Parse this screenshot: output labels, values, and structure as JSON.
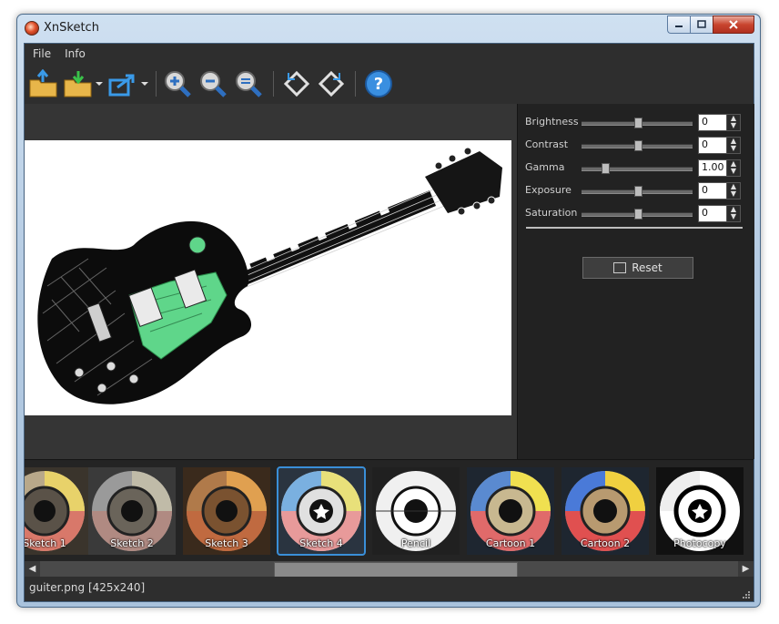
{
  "window": {
    "title": "XnSketch"
  },
  "menu": {
    "items": [
      "File",
      "Info"
    ]
  },
  "toolbar": {
    "buttons": [
      "open-icon",
      "save-icon",
      "export-icon",
      "zoom-in-icon",
      "zoom-out-icon",
      "zoom-fit-icon",
      "rotate-left-icon",
      "rotate-right-icon",
      "help-icon"
    ],
    "help_label": "?"
  },
  "adjustments": [
    {
      "label": "Brightness",
      "value": "0",
      "level": 0.5
    },
    {
      "label": "Contrast",
      "value": "0",
      "level": 0.5
    },
    {
      "label": "Gamma",
      "value": "1.00",
      "level": 0.2
    },
    {
      "label": "Exposure",
      "value": "0",
      "level": 0.5
    },
    {
      "label": "Saturation",
      "value": "0",
      "level": 0.5
    }
  ],
  "reset_label": "Reset",
  "presets": [
    {
      "label": "Sketch 1",
      "selected": false
    },
    {
      "label": "Sketch 2",
      "selected": false
    },
    {
      "label": "Sketch 3",
      "selected": false
    },
    {
      "label": "Sketch 4",
      "selected": true
    },
    {
      "label": "Pencil",
      "selected": false
    },
    {
      "label": "Cartoon 1",
      "selected": false
    },
    {
      "label": "Cartoon 2",
      "selected": false
    },
    {
      "label": "Photocopy",
      "selected": false
    }
  ],
  "status": {
    "text": "guiter.png [425x240]"
  },
  "colors": {
    "accent": "#3a8fd8",
    "panel": "#222222",
    "guitar_pickguard": "#5fd68a"
  }
}
